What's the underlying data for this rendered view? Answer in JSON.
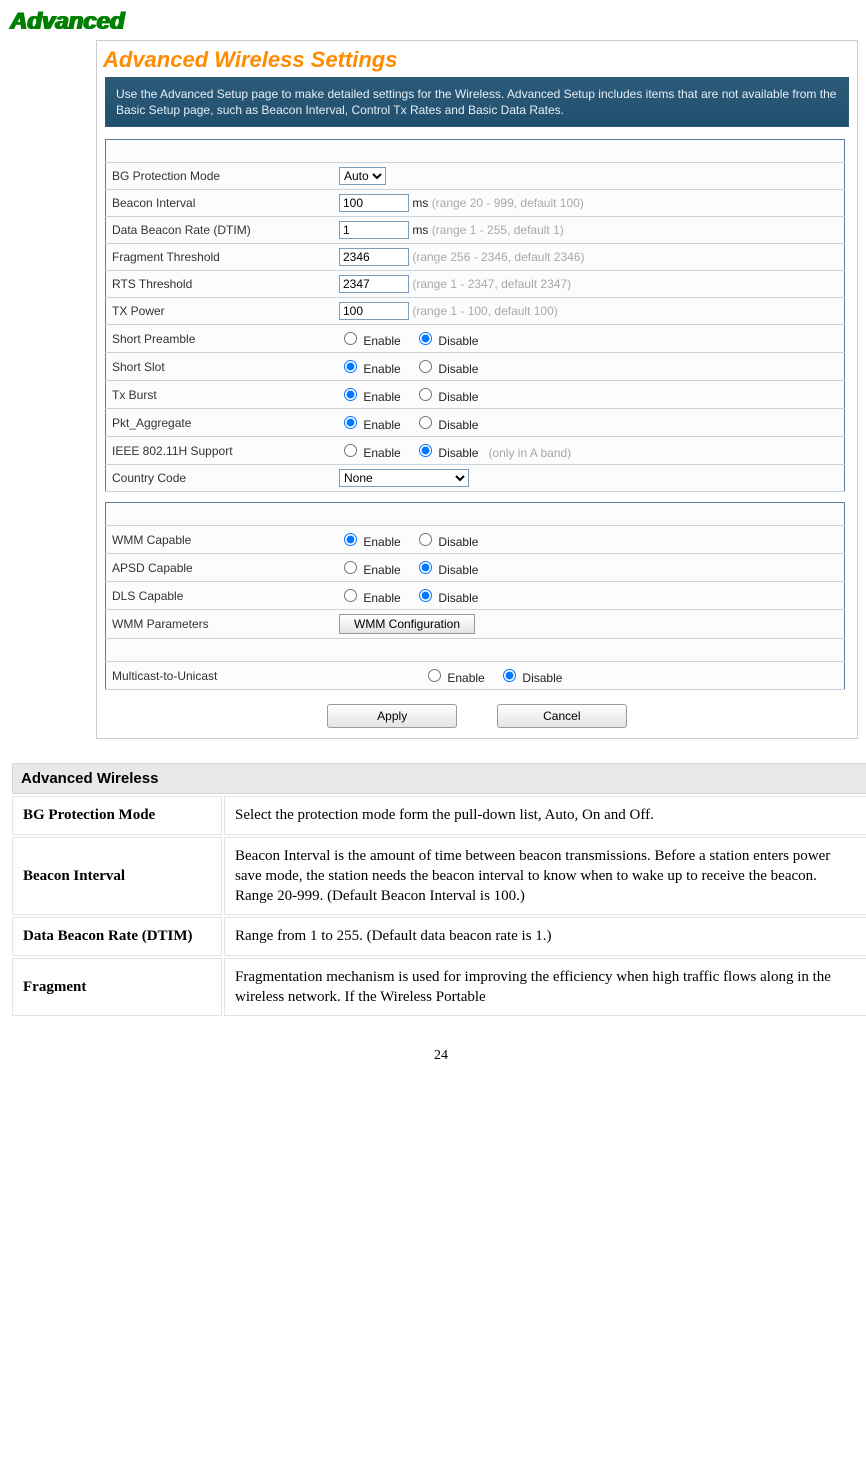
{
  "heading": "Advanced",
  "panel_title": "Advanced Wireless Settings",
  "info_text": "Use the Advanced Setup page to make detailed settings for the Wireless. Advanced Setup includes items that are not available from the Basic Setup page, such as Beacon Interval, Control Tx Rates and Basic Data Rates.",
  "adv": {
    "header": "Advanced Wireless",
    "rows": {
      "bg_protection": {
        "label": "BG Protection Mode",
        "value": "Auto"
      },
      "beacon_interval": {
        "label": "Beacon Interval",
        "value": "100",
        "unit": "ms",
        "hint": "(range 20 - 999, default 100)"
      },
      "dtim": {
        "label": "Data Beacon Rate (DTIM)",
        "value": "1",
        "unit": "ms",
        "hint": "(range 1 - 255, default 1)"
      },
      "frag": {
        "label": "Fragment Threshold",
        "value": "2346",
        "hint": "(range 256 - 2346, default 2346)"
      },
      "rts": {
        "label": "RTS Threshold",
        "value": "2347",
        "hint": "(range 1 - 2347, default 2347)"
      },
      "txpower": {
        "label": "TX Power",
        "value": "100",
        "hint": "(range 1 - 100, default 100)"
      },
      "short_preamble": {
        "label": "Short Preamble",
        "enable": "Enable",
        "disable": "Disable",
        "selected": "disable"
      },
      "short_slot": {
        "label": "Short Slot",
        "enable": "Enable",
        "disable": "Disable",
        "selected": "enable"
      },
      "tx_burst": {
        "label": "Tx Burst",
        "enable": "Enable",
        "disable": "Disable",
        "selected": "enable"
      },
      "pkt_agg": {
        "label": "Pkt_Aggregate",
        "enable": "Enable",
        "disable": "Disable",
        "selected": "enable"
      },
      "ieee80211h": {
        "label": "IEEE 802.11H Support",
        "enable": "Enable",
        "disable": "Disable",
        "selected": "disable",
        "note": "(only in A band)"
      },
      "country": {
        "label": "Country Code",
        "value": "None"
      }
    }
  },
  "wmm": {
    "header": "Wi-Fi Multimedia",
    "rows": {
      "wmm_capable": {
        "label": "WMM Capable",
        "enable": "Enable",
        "disable": "Disable",
        "selected": "enable"
      },
      "apsd": {
        "label": "APSD Capable",
        "enable": "Enable",
        "disable": "Disable",
        "selected": "disable"
      },
      "dls": {
        "label": "DLS Capable",
        "enable": "Enable",
        "disable": "Disable",
        "selected": "disable"
      },
      "wmm_params": {
        "label": "WMM Parameters",
        "button": "WMM Configuration"
      }
    }
  },
  "m2u": {
    "header": "Multicast-to-Unicast Converter",
    "row": {
      "label": "Multicast-to-Unicast",
      "enable": "Enable",
      "disable": "Disable",
      "selected": "disable"
    }
  },
  "buttons": {
    "apply": "Apply",
    "cancel": "Cancel"
  },
  "doc": {
    "header": "Advanced Wireless",
    "rows": [
      {
        "term": "BG Protection Mode",
        "desc": "Select the protection mode form the pull-down list, Auto, On and Off."
      },
      {
        "term": "Beacon Interval",
        "desc": "Beacon Interval is the amount of time between beacon transmissions. Before a station enters power save mode, the station needs the beacon interval to know when to wake up to receive the beacon. Range 20-999. (Default Beacon Interval is 100.)"
      },
      {
        "term": "Data Beacon Rate (DTIM)",
        "desc": "Range from 1 to 255. (Default data beacon rate is 1.)"
      },
      {
        "term": "Fragment",
        "desc": "Fragmentation mechanism is used for improving the efficiency when high traffic flows along in the wireless network. If the Wireless Portable"
      }
    ]
  },
  "page_number": "24"
}
